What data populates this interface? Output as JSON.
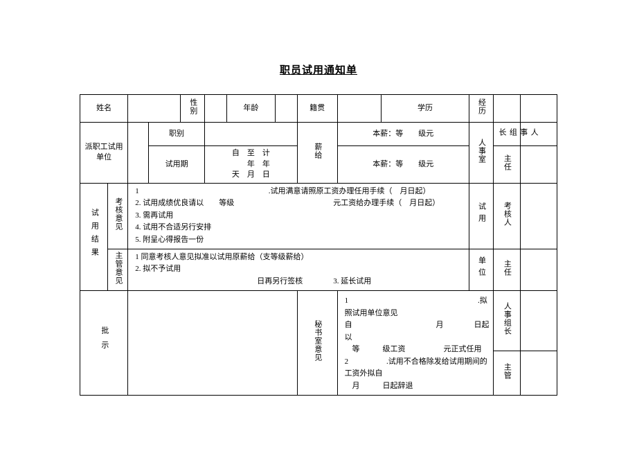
{
  "title": "职员试用通知单",
  "row1": {
    "name_lbl": "姓名",
    "gender_lbl": "性别",
    "age_lbl": "年龄",
    "origin_lbl": "籍贯",
    "edu_lbl": "学历",
    "exp_lbl": "经历"
  },
  "row2": {
    "unit_lbl": "派职工试用单位",
    "rank_lbl": "职别",
    "period_lbl": "试用期",
    "period_val": "自　至　计\n　　年　年\n天　月　日",
    "salary_lbl": "薪给",
    "base1": "本薪：等　　级元",
    "base2": "本薪：等　　级元",
    "hr_room_lbl": "人事室",
    "hr_leader_lbl": "人事组长",
    "director_lbl": "主任"
  },
  "row3": {
    "result_lbl": "试用结果",
    "assess_lbl": "考核意见",
    "assess_body": "1　　　　　　　　　　　　　　　　　.试用满意请照原工资办理任用手续（　月日起）\n2. 试用成绩优良请以　　等级　　　　　　　　　　　　　元工资给办理手续（　月日起）\n3. 需再试用\n4. 试用不合适另行安排\n5. 附呈心得报告一份",
    "mgr_lbl": "主管意见",
    "mgr_body": "1 同意考核人意见拟准以试用原薪给（支等级薪给）\n2. 拟不予试用\n　　　　　　　　　　　　　　　　日再另行签核　　　　3. 延长试用",
    "trial_lbl": "试用",
    "assessor_lbl": "考核人",
    "unit2_lbl": "单位",
    "director2_lbl": "主任"
  },
  "row4": {
    "approve_lbl": "批示",
    "sec_lbl": "秘书室意见",
    "sec_body_a": "1　　　　　　　　　　　　　　　　　.拟照试用单位意见\n自　　　　　　　　　　　月　　　　日起以\n　等　　　级工资　　　　　元正式任用",
    "sec_body_b": "2　　　　　.试用不合格除发给试用期间的工资外拟自\n　月　　　日起辞退",
    "hr_leader2_lbl": "人事组长",
    "mgr2_lbl": "主管"
  }
}
